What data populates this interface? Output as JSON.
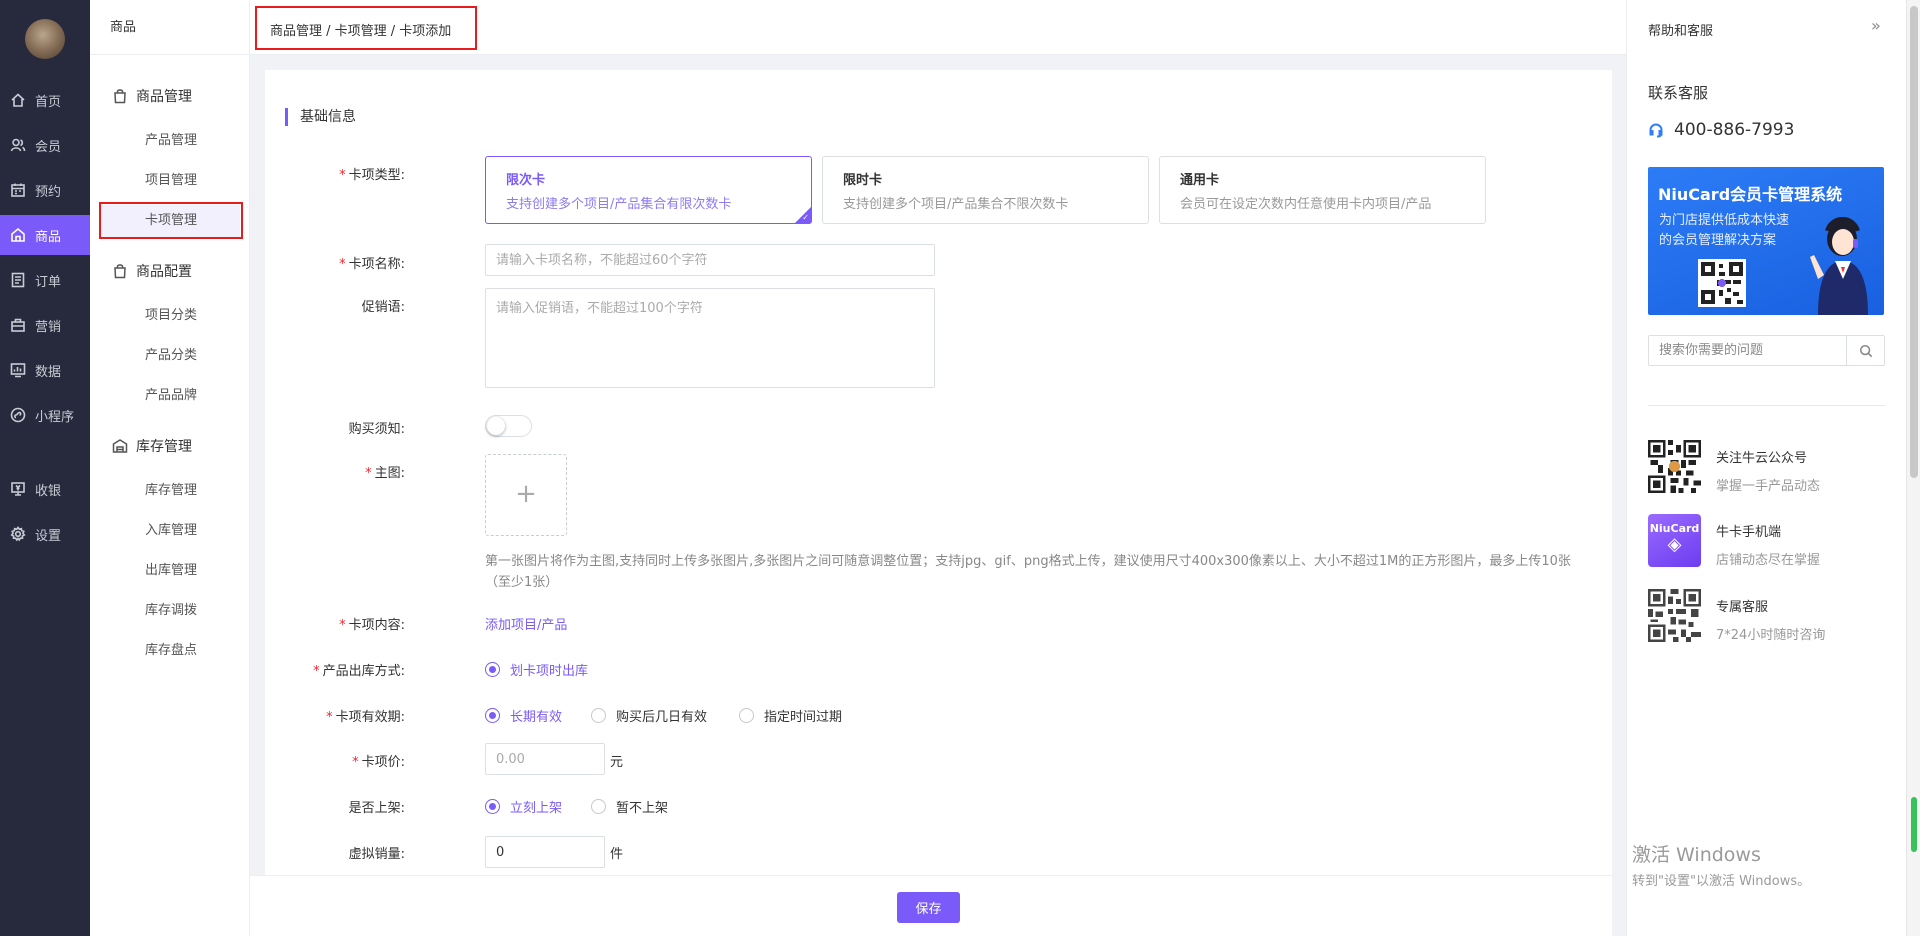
{
  "nav": {
    "items": [
      {
        "label": "首页",
        "icon": "home-icon"
      },
      {
        "label": "会员",
        "icon": "member-icon"
      },
      {
        "label": "预约",
        "icon": "calendar-icon"
      },
      {
        "label": "商品",
        "icon": "goods-icon"
      },
      {
        "label": "订单",
        "icon": "order-icon"
      },
      {
        "label": "营销",
        "icon": "marketing-icon"
      },
      {
        "label": "数据",
        "icon": "data-icon"
      },
      {
        "label": "小程序",
        "icon": "miniapp-icon"
      },
      {
        "label": "收银",
        "icon": "cashier-icon"
      },
      {
        "label": "设置",
        "icon": "gear-icon"
      }
    ],
    "active_index": 3
  },
  "subnav": {
    "header": "商品",
    "groups": [
      {
        "label": "商品管理",
        "items": [
          "产品管理",
          "项目管理",
          "卡项管理"
        ]
      },
      {
        "label": "商品配置",
        "items": [
          "项目分类",
          "产品分类",
          "产品品牌"
        ]
      },
      {
        "label": "库存管理",
        "items": [
          "库存管理",
          "入库管理",
          "出库管理",
          "库存调拨",
          "库存盘点"
        ]
      }
    ],
    "active_item": "卡项管理"
  },
  "breadcrumb": "商品管理 / 卡项管理 / 卡项添加",
  "form": {
    "section_title": "基础信息",
    "card_type": {
      "label": "卡项类型:",
      "options": [
        {
          "title": "限次卡",
          "desc": "支持创建多个项目/产品集合有限次数卡",
          "selected": true
        },
        {
          "title": "限时卡",
          "desc": "支持创建多个项目/产品集合不限次数卡",
          "selected": false
        },
        {
          "title": "通用卡",
          "desc": "会员可在设定次数内任意使用卡内项目/产品",
          "selected": false
        }
      ]
    },
    "name": {
      "label": "卡项名称:",
      "placeholder": "请输入卡项名称，不能超过60个字符",
      "value": ""
    },
    "promo": {
      "label": "促销语:",
      "placeholder": "请输入促销语，不能超过100个字符",
      "value": ""
    },
    "notice": {
      "label": "购买须知:",
      "on": false
    },
    "main_image": {
      "label": "主图:",
      "hint": "第一张图片将作为主图,支持同时上传多张图片,多张图片之间可随意调整位置；支持jpg、gif、png格式上传，建议使用尺寸400x300像素以上、大小不超过1M的正方形图片，最多上传10张（至少1张）"
    },
    "content": {
      "label": "卡项内容:",
      "link": "添加项目/产品"
    },
    "stock_out": {
      "label": "产品出库方式:",
      "options": [
        {
          "text": "划卡项时出库",
          "checked": true
        }
      ]
    },
    "validity": {
      "label": "卡项有效期:",
      "options": [
        {
          "text": "长期有效",
          "checked": true
        },
        {
          "text": "购买后几日有效",
          "checked": false
        },
        {
          "text": "指定时间过期",
          "checked": false
        }
      ]
    },
    "price": {
      "label": "卡项价:",
      "placeholder": "0.00",
      "unit": "元"
    },
    "listing": {
      "label": "是否上架:",
      "options": [
        {
          "text": "立刻上架",
          "checked": true
        },
        {
          "text": "暂不上架",
          "checked": false
        }
      ]
    },
    "virtual_sales": {
      "label": "虚拟销量:",
      "value": "0",
      "unit": "件"
    }
  },
  "footer": {
    "save_label": "保存"
  },
  "help": {
    "title": "帮助和客服",
    "contact_title": "联系客服",
    "phone": "400-886-7993",
    "banner": {
      "title": "NiuCard会员卡管理系统",
      "subtitle": "为门店提供低成本快速的会员管理解决方案"
    },
    "search_placeholder": "搜索你需要的问题",
    "items": [
      {
        "title": "关注牛云公众号",
        "desc": "掌握一手产品动态"
      },
      {
        "title": "牛卡手机端",
        "desc": "店铺动态尽在掌握",
        "logo_text": "NiuCard"
      },
      {
        "title": "专属客服",
        "desc": "7*24小时随时咨询"
      }
    ]
  },
  "watermark": {
    "line1": "激活 Windows",
    "line2": "转到\"设置\"以激活 Windows。"
  },
  "colors": {
    "accent": "#7a5af8",
    "nav_bg": "#262a3c",
    "required": "#f5222d",
    "highlight_box": "#e81c1c"
  }
}
